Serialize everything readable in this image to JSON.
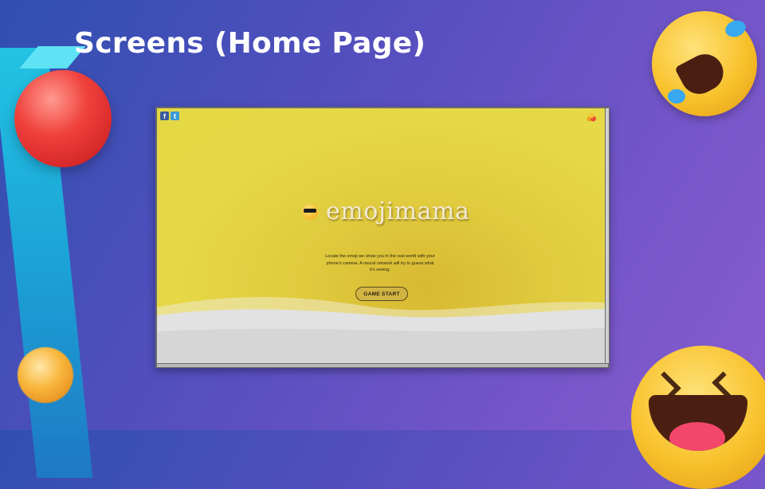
{
  "slide": {
    "title": "Screens (Home Page)"
  },
  "app": {
    "logo_text": "emojimama",
    "tagline": "Locate the emoji we show you in the real world with your phone's camera. A neural network will try to guess what it's seeing.",
    "start_button": "GAME START",
    "social": {
      "facebook_glyph": "f",
      "twitter_glyph": "t"
    },
    "icons": [
      "facebook-icon",
      "twitter-icon",
      "emoji-cluster-icon",
      "sunglasses-emoji-icon"
    ]
  },
  "colors": {
    "background_start": "#2f4fb0",
    "background_end": "#8a5ccf",
    "app_yellow": "#e4d944",
    "title_white": "#ffffff"
  }
}
